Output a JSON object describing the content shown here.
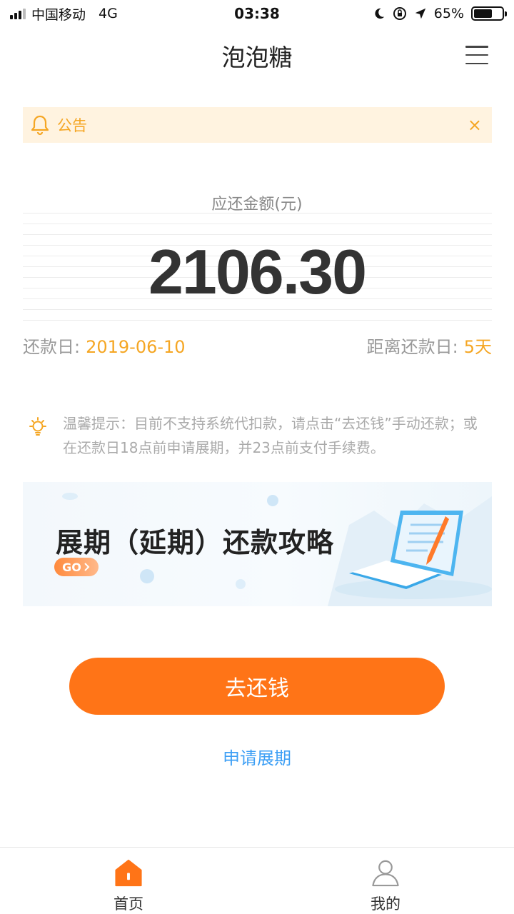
{
  "status_bar": {
    "carrier": "中国移动",
    "network": "4G",
    "time": "03:38",
    "battery": "65%",
    "battery_level": 0.65
  },
  "nav": {
    "title": "泡泡糖",
    "menu_icon": "hamburger-menu-icon"
  },
  "notice": {
    "icon": "bell-icon",
    "text": "公告",
    "close": "×"
  },
  "amount": {
    "label": "应还金额(元)",
    "value": "2106.30"
  },
  "due": {
    "date_label": "还款日:",
    "date_value": "2019-06-10",
    "remaining_label": "距离还款日:",
    "remaining_value": "5天"
  },
  "tip": {
    "icon": "lightbulb-icon",
    "text": "温馨提示：目前不支持系统代扣款，请点击“去还钱”手动还款；或在还款日18点前申请展期，并23点前支付手续费。"
  },
  "banner": {
    "title": "展期（延期）还款攻略",
    "go": "GO"
  },
  "actions": {
    "repay": "去还钱",
    "extend": "申请展期"
  },
  "tabbar": {
    "items": [
      {
        "label": "首页",
        "icon": "home-icon",
        "active": true
      },
      {
        "label": "我的",
        "icon": "user-icon",
        "active": false
      }
    ]
  },
  "colors": {
    "accent": "#ff7417",
    "warning": "#f5a623",
    "link": "#3d9ff5"
  }
}
